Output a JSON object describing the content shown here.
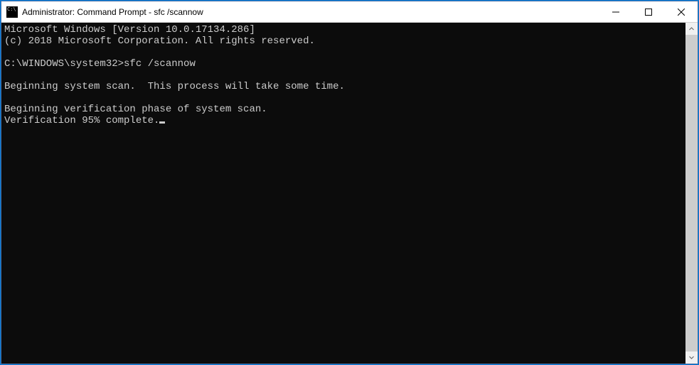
{
  "titlebar": {
    "title": "Administrator: Command Prompt - sfc  /scannow"
  },
  "console": {
    "line1": "Microsoft Windows [Version 10.0.17134.286]",
    "line2": "(c) 2018 Microsoft Corporation. All rights reserved.",
    "blank1": "",
    "prompt_line": "C:\\WINDOWS\\system32>sfc /scannow",
    "blank2": "",
    "scan_begin": "Beginning system scan.  This process will take some time.",
    "blank3": "",
    "verify_begin": "Beginning verification phase of system scan.",
    "verify_progress": "Verification 95% complete."
  }
}
